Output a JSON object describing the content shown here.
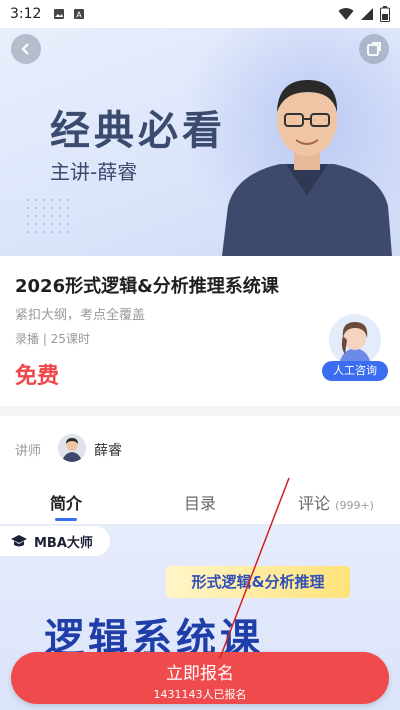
{
  "status_bar": {
    "time": "3:12"
  },
  "hero": {
    "title": "经典必看",
    "subtitle": "主讲-薛睿"
  },
  "course": {
    "title": "2026形式逻辑&分析推理系统课",
    "tagline": "紧扣大纲，考点全覆盖",
    "meta": "录播 | 25课时",
    "price": "免费"
  },
  "consult": {
    "label": "人工咨询"
  },
  "teacher": {
    "label": "讲师",
    "name": "薛睿"
  },
  "tabs": [
    {
      "label": "简介",
      "count": ""
    },
    {
      "label": "目录",
      "count": ""
    },
    {
      "label": "评论",
      "count": "(999+)"
    }
  ],
  "promo": {
    "brand": "MBA大师",
    "tag": "形式逻辑&分析推理",
    "headline": "逻辑系统课"
  },
  "signup": {
    "label": "立即报名",
    "sub": "1431143人已报名"
  },
  "colors": {
    "accent_red": "#ef4b4d",
    "accent_blue": "#3b6df0",
    "price_red": "#f0464a"
  },
  "icons": [
    "back-icon",
    "share-icon",
    "wifi-icon",
    "signal-icon",
    "battery-icon",
    "image-icon",
    "a-icon"
  ]
}
